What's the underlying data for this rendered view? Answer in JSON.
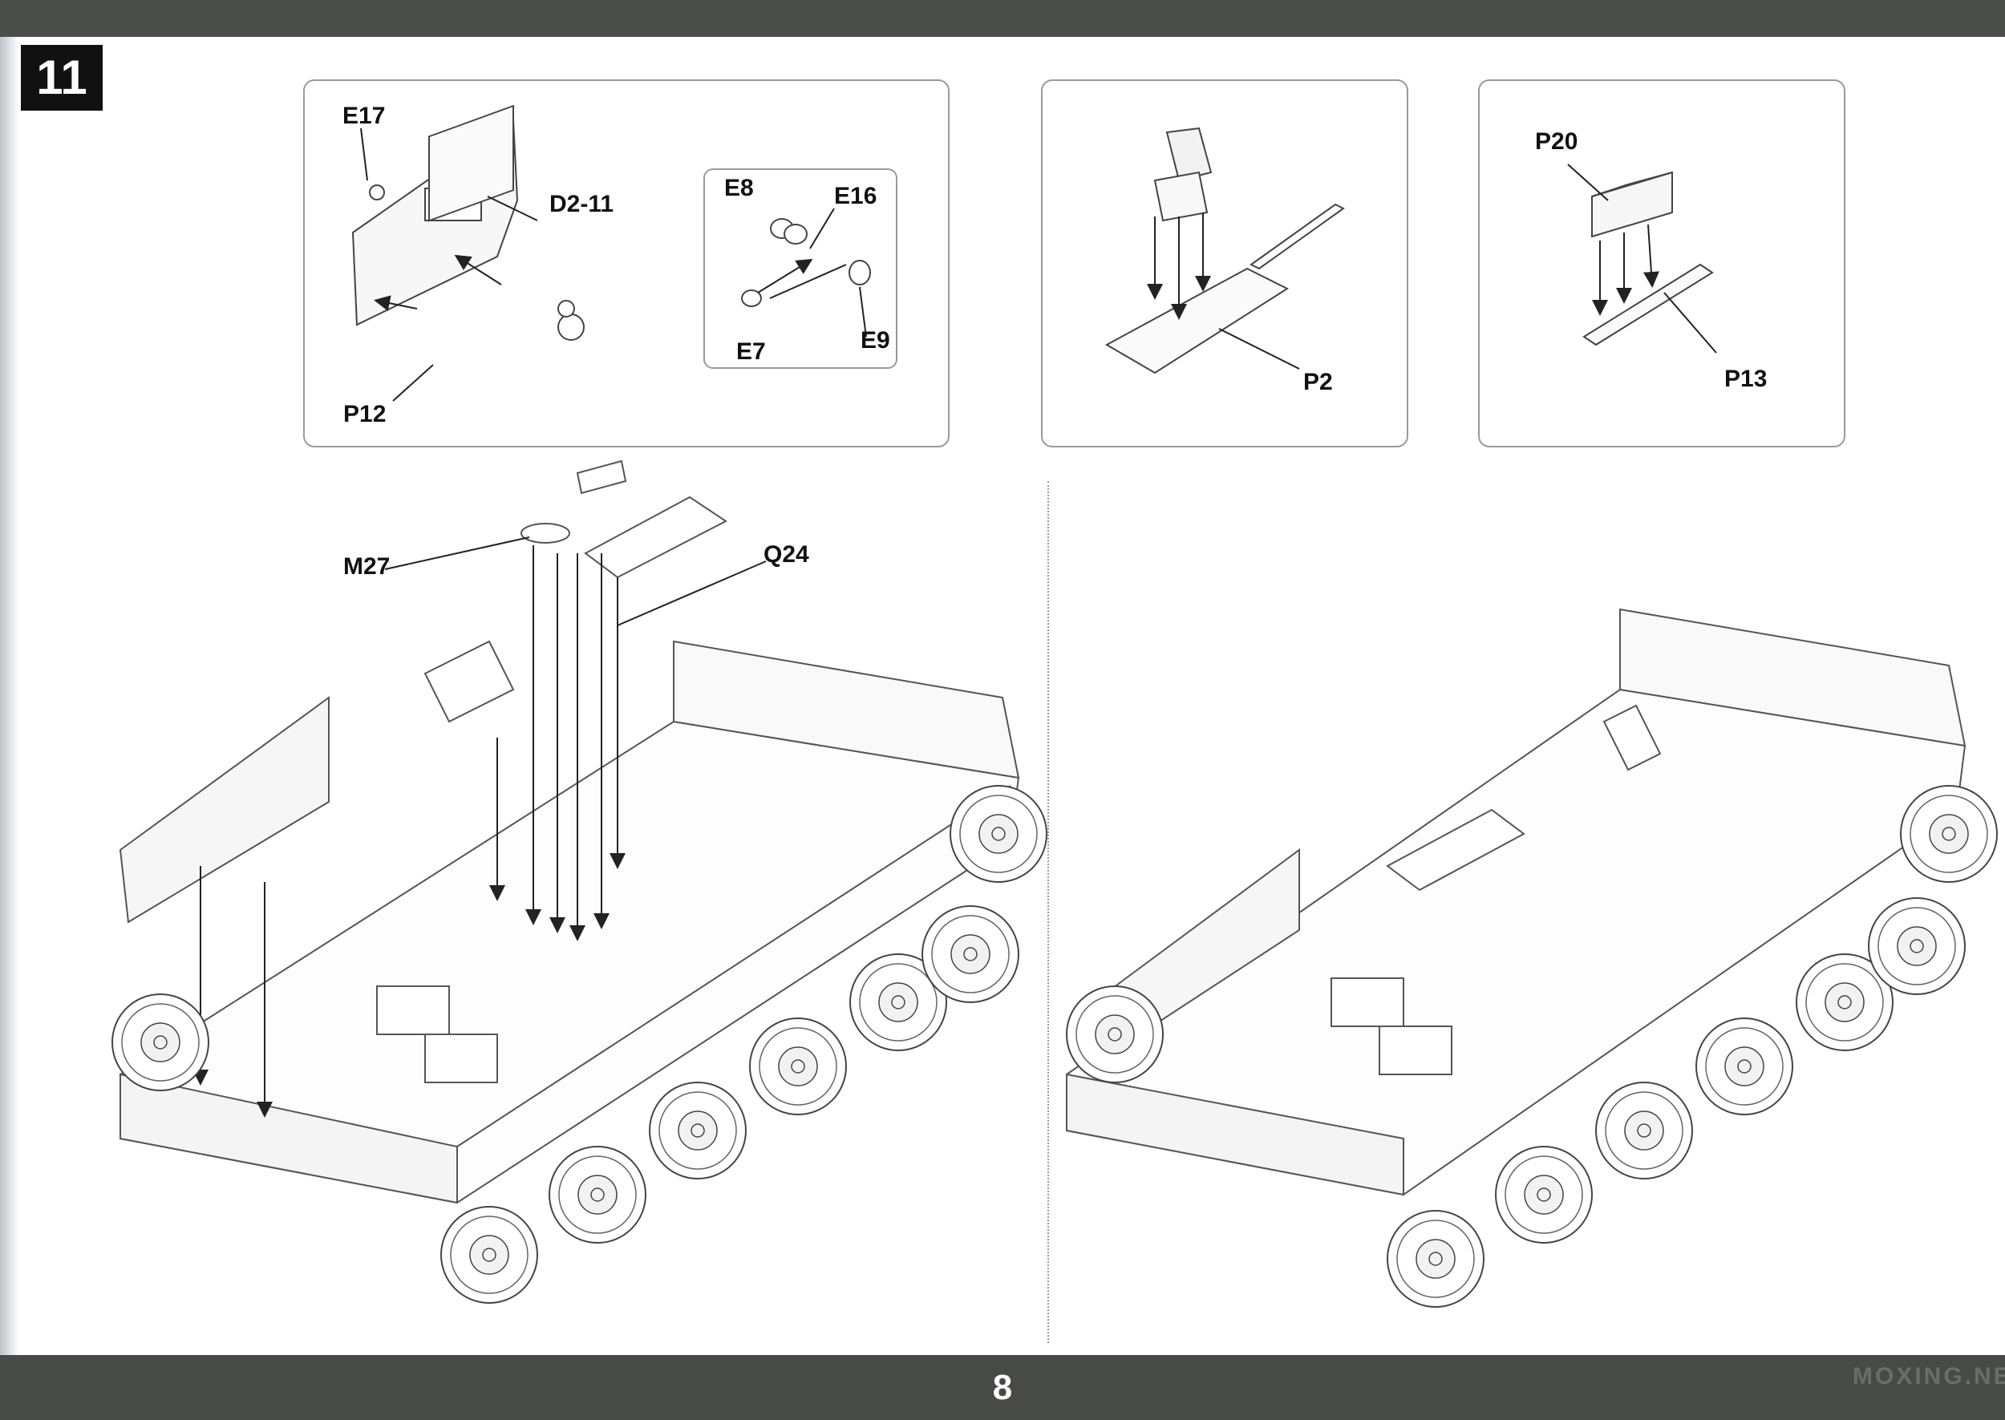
{
  "step": {
    "number": "11"
  },
  "page": {
    "number": "8",
    "watermark": "MOXING.NET"
  },
  "insets": {
    "side_panel": {
      "labels": {
        "e17": "E17",
        "d2_11": "D2-11",
        "p12": "P12"
      }
    },
    "hardware": {
      "labels": {
        "e8": "E8",
        "e16": "E16",
        "e7": "E7",
        "e9": "E9"
      }
    },
    "seat": {
      "labels": {
        "p2": "P2"
      }
    },
    "box": {
      "labels": {
        "p20": "P20",
        "p13": "P13"
      }
    }
  },
  "main": {
    "labels": {
      "m27": "M27",
      "q24": "Q24"
    }
  },
  "icons": [
    "step-badge",
    "hull-assembly",
    "road-wheel"
  ]
}
